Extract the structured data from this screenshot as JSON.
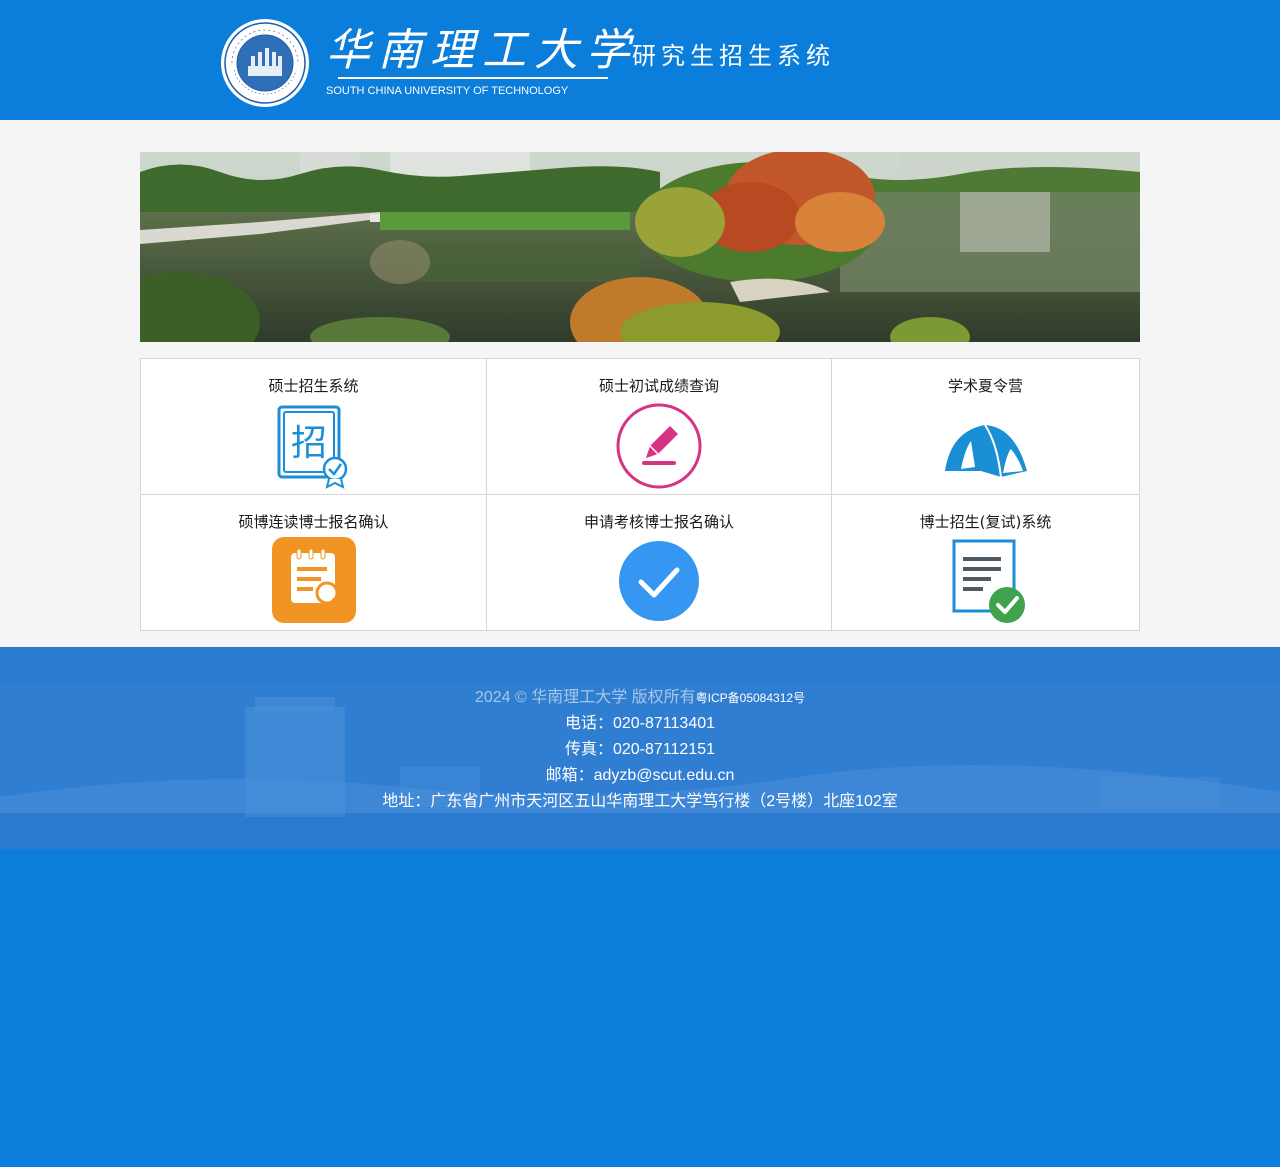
{
  "header": {
    "university_cn": "华南理工大学",
    "university_en": "SOUTH CHINA UNIVERSITY OF TECHNOLOGY",
    "system_name": "研究生招生系统"
  },
  "services": [
    {
      "label": "硕士招生系统",
      "icon": "enrollment-certificate-icon"
    },
    {
      "label": "硕士初试成绩查询",
      "icon": "pencil-circle-icon"
    },
    {
      "label": "学术夏令营",
      "icon": "tent-icon"
    },
    {
      "label": "硕博连读博士报名确认",
      "icon": "clipboard-search-icon"
    },
    {
      "label": "申请考核博士报名确认",
      "icon": "checkmark-circle-icon"
    },
    {
      "label": "博士招生(复试)系统",
      "icon": "document-check-icon"
    }
  ],
  "footer": {
    "copyright": "2024  © 华南理工大学 版权所有",
    "icp": "粤ICP备05084312号",
    "phone": "电话：020-87113401",
    "fax": "传真：020-87112151",
    "email": "邮箱：adyzb@scut.edu.cn",
    "address": "地址：广东省广州市天河区五山华南理工大学笃行楼（2号楼）北座102室"
  },
  "colors": {
    "primary_blue": "#0b7ddb",
    "footer_blue": "#2a7bd0",
    "pencil_pink": "#d63384",
    "tent_blue": "#1a8fd6",
    "clipboard_orange": "#f29423",
    "check_blue": "#3697f2",
    "doc_green": "#3fa34d"
  }
}
